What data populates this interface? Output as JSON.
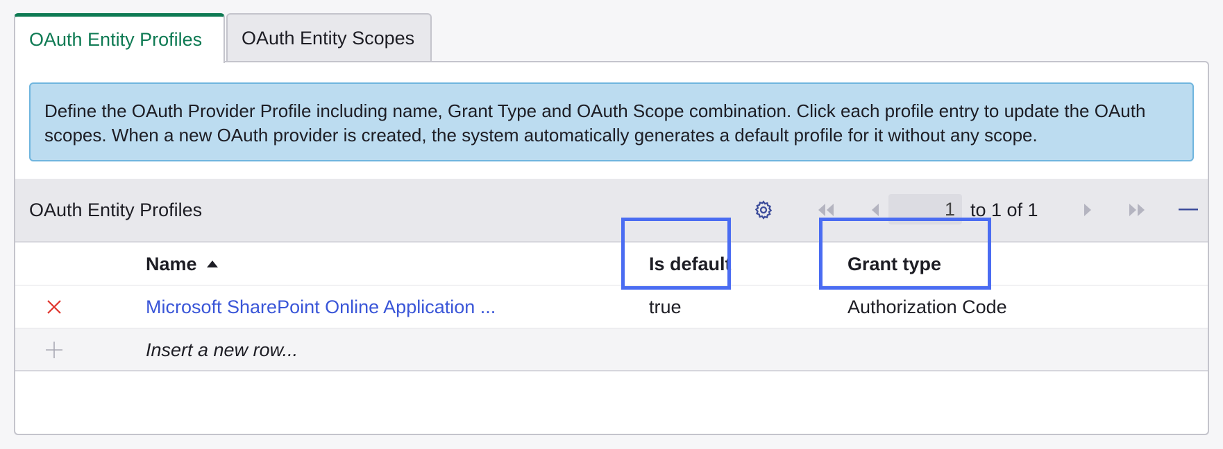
{
  "tabs": [
    {
      "label": "OAuth Entity Profiles",
      "active": true
    },
    {
      "label": "OAuth Entity Scopes",
      "active": false
    }
  ],
  "info_text": "Define the OAuth Provider Profile including name, Grant Type and OAuth Scope combination. Click each profile entry to update the OAuth scopes. When a new OAuth provider is created, the system automatically generates a default profile for it without any scope.",
  "list": {
    "title": "OAuth Entity Profiles",
    "pagination": {
      "current_page": "1",
      "range_text": "to 1 of 1"
    },
    "columns": {
      "name": "Name",
      "is_default": "Is default",
      "grant_type": "Grant type"
    },
    "rows": [
      {
        "name": "Microsoft SharePoint Online Application ...",
        "is_default": "true",
        "grant_type": "Authorization Code"
      }
    ],
    "insert_row_text": "Insert a new row..."
  },
  "colors": {
    "accent": "#0e7a53",
    "link": "#3a56d8",
    "highlight": "#4a6cf2",
    "delete": "#e0322a"
  },
  "icons": [
    "gear-icon",
    "first-page-icon",
    "previous-page-icon",
    "next-page-icon",
    "last-page-icon",
    "collapse-icon",
    "sort-ascending-icon",
    "delete-icon",
    "add-icon"
  ]
}
